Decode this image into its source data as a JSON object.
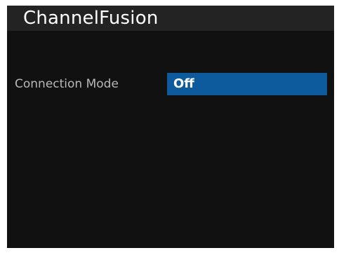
{
  "app": {
    "title": "ChannelFusion"
  },
  "settings": [
    {
      "label": "Connection Mode",
      "value": "Off"
    }
  ],
  "colors": {
    "background": "#111111",
    "titlebar": "#232323",
    "selection": "#0d5b9c",
    "label_text": "#b8b8b8",
    "value_text": "#ffffff"
  }
}
